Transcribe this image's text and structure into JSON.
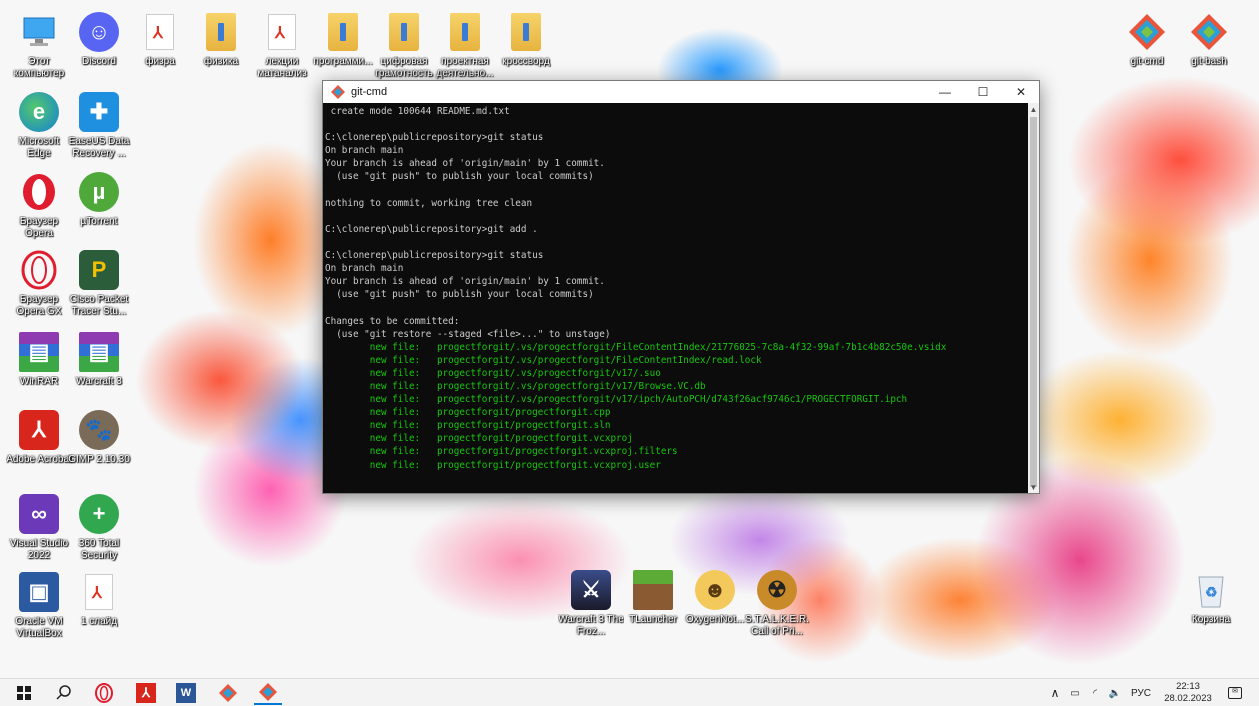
{
  "console": {
    "title": "git-cmd",
    "lines": [
      {
        "text": " create mode 100644 README.md.txt",
        "color": "gray"
      },
      {
        "text": "",
        "color": "gray"
      },
      {
        "text": "C:\\clonerep\\publicrepository>git status",
        "color": "gray"
      },
      {
        "text": "On branch main",
        "color": "gray"
      },
      {
        "text": "Your branch is ahead of 'origin/main' by 1 commit.",
        "color": "gray"
      },
      {
        "text": "  (use \"git push\" to publish your local commits)",
        "color": "gray"
      },
      {
        "text": "",
        "color": "gray"
      },
      {
        "text": "nothing to commit, working tree clean",
        "color": "gray"
      },
      {
        "text": "",
        "color": "gray"
      },
      {
        "text": "C:\\clonerep\\publicrepository>git add .",
        "color": "gray"
      },
      {
        "text": "",
        "color": "gray"
      },
      {
        "text": "C:\\clonerep\\publicrepository>git status",
        "color": "gray"
      },
      {
        "text": "On branch main",
        "color": "gray"
      },
      {
        "text": "Your branch is ahead of 'origin/main' by 1 commit.",
        "color": "gray"
      },
      {
        "text": "  (use \"git push\" to publish your local commits)",
        "color": "gray"
      },
      {
        "text": "",
        "color": "gray"
      },
      {
        "text": "Changes to be committed:",
        "color": "gray"
      },
      {
        "text": "  (use \"git restore --staged <file>...\" to unstage)",
        "color": "gray"
      },
      {
        "text": "        new file:   progectforgit/.vs/progectforgit/FileContentIndex/21776025-7c8a-4f32-99af-7b1c4b82c50e.vsidx",
        "color": "green"
      },
      {
        "text": "        new file:   progectforgit/.vs/progectforgit/FileContentIndex/read.lock",
        "color": "green"
      },
      {
        "text": "        new file:   progectforgit/.vs/progectforgit/v17/.suo",
        "color": "green"
      },
      {
        "text": "        new file:   progectforgit/.vs/progectforgit/v17/Browse.VC.db",
        "color": "green"
      },
      {
        "text": "        new file:   progectforgit/.vs/progectforgit/v17/ipch/AutoPCH/d743f26acf9746c1/PROGECTFORGIT.ipch",
        "color": "green"
      },
      {
        "text": "        new file:   progectforgit/progectforgit.cpp",
        "color": "green"
      },
      {
        "text": "        new file:   progectforgit/progectforgit.sln",
        "color": "green"
      },
      {
        "text": "        new file:   progectforgit/progectforgit.vcxproj",
        "color": "green"
      },
      {
        "text": "        new file:   progectforgit/progectforgit.vcxproj.filters",
        "color": "green"
      },
      {
        "text": "        new file:   progectforgit/progectforgit.vcxproj.user",
        "color": "green"
      }
    ]
  },
  "desktop": {
    "icons": {
      "this_pc": "Этот компьютер",
      "discord": "Discord",
      "fizra": "физра",
      "fizika": "физика",
      "lekcii": "лекции матанализ",
      "programm": "программи...",
      "cifrovaya": "цифровая грамотность",
      "proektnaya": "проектная деятельно...",
      "krossvord": "кроссворд",
      "git_cmd": "git-cmd",
      "git_bash": "git-bash",
      "edge": "Microsoft Edge",
      "easeus": "EaseUS Data Recovery ...",
      "opera": "Браузер Opera",
      "utorrent": "µTorrent",
      "opera_gx": "Браузер Opera GX",
      "cisco": "Cisco Packet Tracer Stu...",
      "winrar": "WinRAR",
      "warcraft3": "Warcraft 3",
      "acrobat": "Adobe Acrobat",
      "gimp": "GIMP 2.10.30",
      "visual_studio": "Visual Studio 2022",
      "total_security": "360 Total Security",
      "virtualbox": "Oracle VM VirtualBox",
      "one_slide": "1 слайд",
      "warcraft_froz": "Warcraft 3 The Froz...",
      "tlauncher": "TLauncher",
      "oxygen": "OxygenNot...",
      "stalker": "S.T.A.L.K.E.R. Call of Pri...",
      "recycle": "Корзина"
    }
  },
  "taskbar": {
    "lang": "РУС",
    "time": "22:13",
    "date": "28.02.2023"
  }
}
